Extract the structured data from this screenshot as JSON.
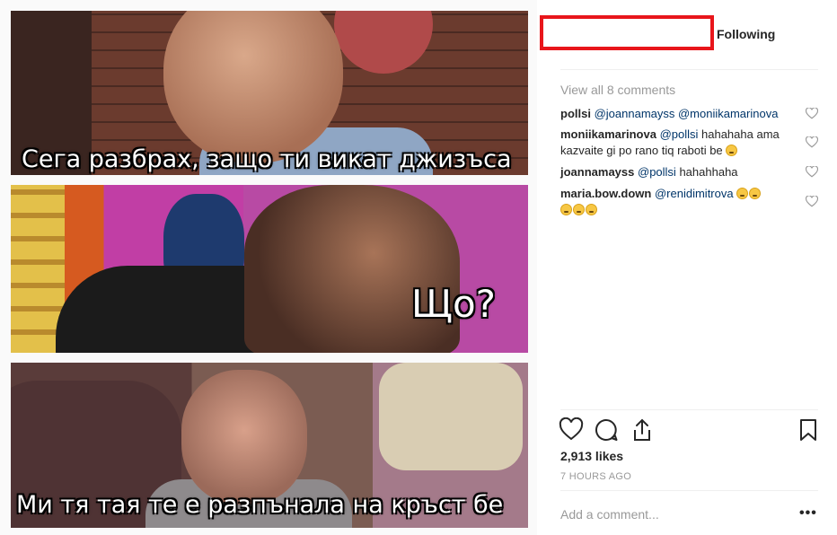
{
  "meme": {
    "captions": [
      "Сега разбрах, защо ти викат джизъса",
      "Що?",
      "Ми тя тая те е разпънала на кръст бе"
    ]
  },
  "header": {
    "follow_label": "Following"
  },
  "comments": {
    "view_all": "View all 8 comments",
    "items": [
      {
        "user": "pollsi",
        "mention": "@joannamayss @moniikamarinova",
        "text": "",
        "emojis": 0
      },
      {
        "user": "moniikamarinova",
        "mention": "@pollsi",
        "text": "hahahaha ama kazvaite gi po rano tiq raboti be",
        "emojis": 1
      },
      {
        "user": "joannamayss",
        "mention": "@pollsi",
        "text": "hahahhaha",
        "emojis": 0
      },
      {
        "user": "maria.bow.down",
        "mention": "@renidimitrova",
        "text": "",
        "emojis": 5
      }
    ]
  },
  "actions": {
    "icons": [
      "heart-icon",
      "comment-icon",
      "share-icon",
      "bookmark-icon"
    ]
  },
  "likes": "2,913 likes",
  "timestamp": "7 HOURS AGO",
  "add_comment_placeholder": "Add a comment...",
  "more_label": "•••"
}
